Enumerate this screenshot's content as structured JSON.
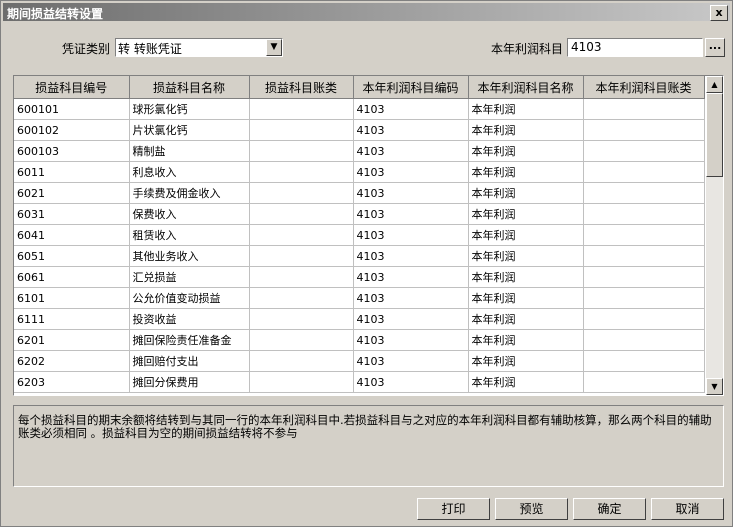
{
  "window": {
    "title": "期间损益结转设置",
    "close_label": "x"
  },
  "voucher_type": {
    "label": "凭证类别",
    "value": "转 转账凭证"
  },
  "profit_account": {
    "label": "本年利润科目",
    "value": "4103",
    "browse_label": "..."
  },
  "table": {
    "columns": [
      "损益科目编号",
      "损益科目名称",
      "损益科目账类",
      "本年利润科目编码",
      "本年利润科目名称",
      "本年利润科目账类"
    ],
    "rows": [
      [
        "600101",
        "球形氯化钙",
        "",
        "4103",
        "本年利润",
        ""
      ],
      [
        "600102",
        "片状氯化钙",
        "",
        "4103",
        "本年利润",
        ""
      ],
      [
        "600103",
        "精制盐",
        "",
        "4103",
        "本年利润",
        ""
      ],
      [
        "6011",
        "利息收入",
        "",
        "4103",
        "本年利润",
        ""
      ],
      [
        "6021",
        "手续费及佣金收入",
        "",
        "4103",
        "本年利润",
        ""
      ],
      [
        "6031",
        "保费收入",
        "",
        "4103",
        "本年利润",
        ""
      ],
      [
        "6041",
        "租赁收入",
        "",
        "4103",
        "本年利润",
        ""
      ],
      [
        "6051",
        "其他业务收入",
        "",
        "4103",
        "本年利润",
        ""
      ],
      [
        "6061",
        "汇兑损益",
        "",
        "4103",
        "本年利润",
        ""
      ],
      [
        "6101",
        "公允价值变动损益",
        "",
        "4103",
        "本年利润",
        ""
      ],
      [
        "6111",
        "投资收益",
        "",
        "4103",
        "本年利润",
        ""
      ],
      [
        "6201",
        "摊回保险责任准备金",
        "",
        "4103",
        "本年利润",
        ""
      ],
      [
        "6202",
        "摊回赔付支出",
        "",
        "4103",
        "本年利润",
        ""
      ],
      [
        "6203",
        "摊回分保费用",
        "",
        "4103",
        "本年利润",
        ""
      ]
    ]
  },
  "note": "每个损益科目的期末余额将结转到与其同一行的本年利润科目中.若损益科目与之对应的本年利润科目都有辅助核算，那么两个科目的辅助账类必须相同 。损益科目为空的期间损益结转将不参与",
  "buttons": {
    "print": "打印",
    "preview": "预览",
    "ok": "确定",
    "cancel": "取消"
  }
}
